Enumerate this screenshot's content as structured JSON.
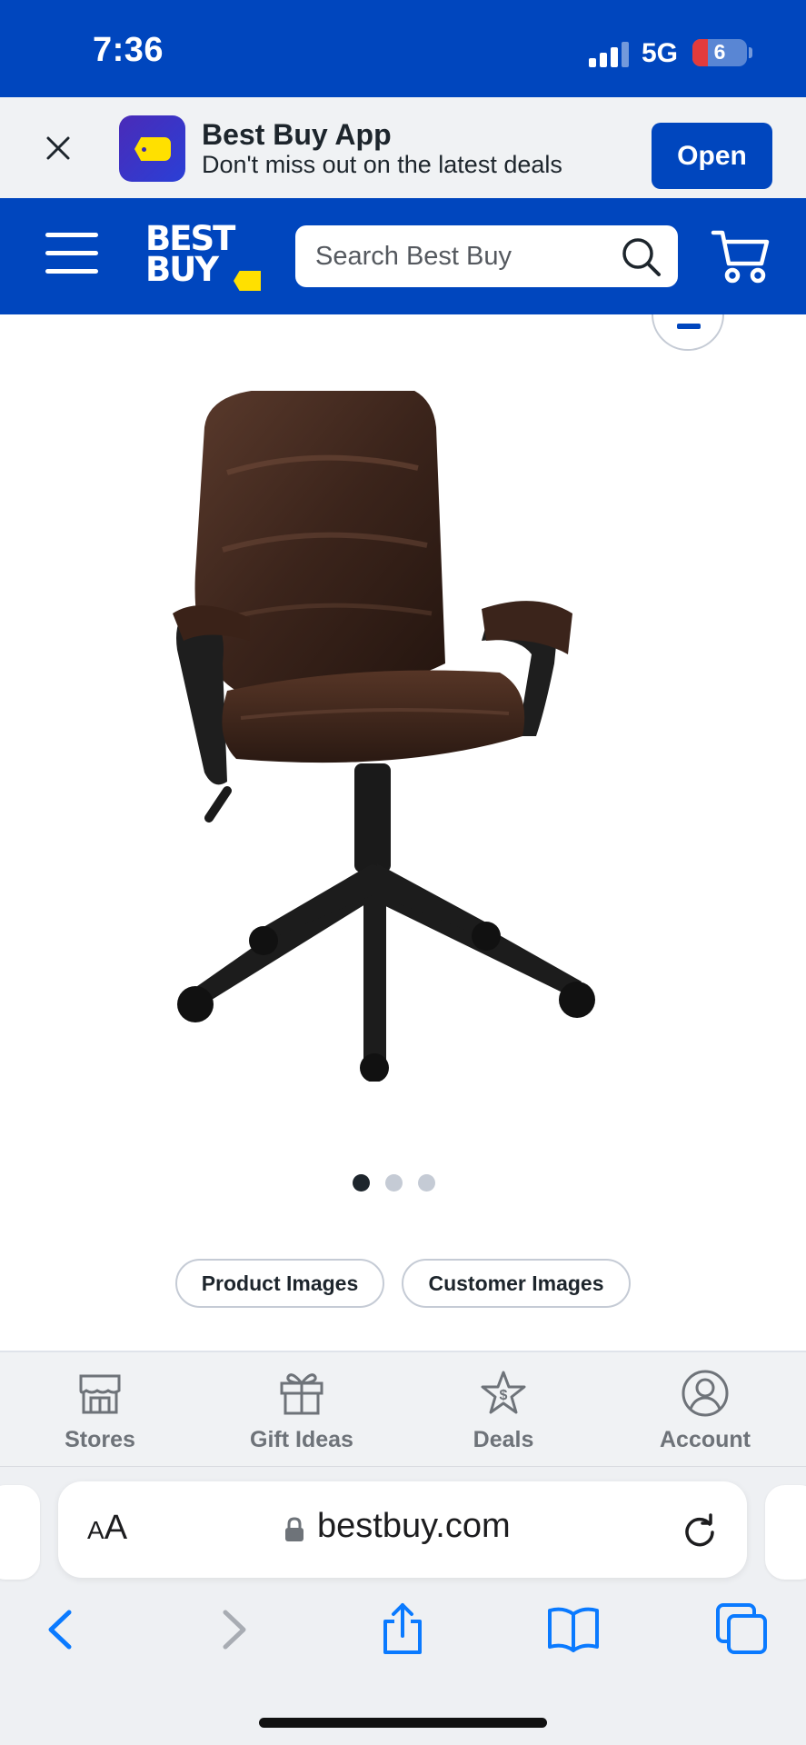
{
  "status_bar": {
    "time": "7:36",
    "network": "5G",
    "battery_level": "6",
    "background_color": "#0046be"
  },
  "app_banner": {
    "title": "Best Buy App",
    "subtitle": "Don't miss out on the latest deals",
    "open_label": "Open",
    "close_icon": "close-icon",
    "app_icon": "best-buy-tag-icon"
  },
  "header": {
    "logo_text_line1": "BEST",
    "logo_text_line2": "BUY",
    "search": {
      "placeholder": "Search Best Buy",
      "value": ""
    },
    "menu_icon": "hamburger-menu-icon",
    "search_icon": "search-icon",
    "cart_icon": "cart-icon",
    "brand_color": "#0046be",
    "accent_color": "#ffe000"
  },
  "product": {
    "image_icon": "office-chair-image",
    "carousel": {
      "total": 3,
      "active_index": 1
    },
    "buttons": {
      "product_images": "Product Images",
      "customer_images": "Customer Images"
    }
  },
  "bottom_nav": {
    "items": [
      {
        "label": "Stores",
        "icon": "store-icon"
      },
      {
        "label": "Gift Ideas",
        "icon": "gift-icon"
      },
      {
        "label": "Deals",
        "icon": "deals-star-icon"
      },
      {
        "label": "Account",
        "icon": "account-icon"
      }
    ]
  },
  "browser": {
    "aa_label_small": "A",
    "aa_label_large": "A",
    "url": "bestbuy.com",
    "toolbar": [
      "back-icon",
      "forward-icon",
      "share-icon",
      "bookmarks-icon",
      "tabs-icon"
    ],
    "accent_color": "#0a7aff"
  }
}
